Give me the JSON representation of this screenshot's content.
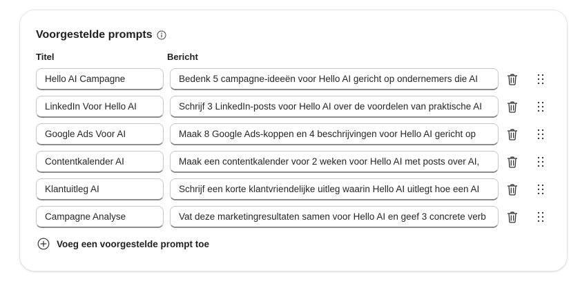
{
  "section": {
    "title": "Voorgestelde prompts",
    "info_icon": "info-icon"
  },
  "columns": {
    "title": "Titel",
    "message": "Bericht"
  },
  "prompts": [
    {
      "title": "Hello AI Campagne",
      "message": "Bedenk 5 campagne-ideeën voor Hello AI gericht op ondernemers die AI"
    },
    {
      "title": "LinkedIn Voor Hello AI",
      "message": "Schrijf 3 LinkedIn-posts voor Hello AI over de voordelen van praktische AI"
    },
    {
      "title": "Google Ads Voor AI",
      "message": "Maak 8 Google Ads-koppen en 4 beschrijvingen voor Hello AI gericht op"
    },
    {
      "title": "Contentkalender AI",
      "message": "Maak een contentkalender voor 2 weken voor Hello AI met posts over AI,"
    },
    {
      "title": "Klantuitleg AI",
      "message": "Schrijf een korte klantvriendelijke uitleg waarin Hello AI uitlegt hoe een AI"
    },
    {
      "title": "Campagne Analyse",
      "message": "Vat deze marketingresultaten samen voor Hello AI en geef 3 concrete verb"
    }
  ],
  "add_button": {
    "label": "Voeg een voorgestelde prompt toe",
    "icon": "plus-circle-icon"
  },
  "row_icons": {
    "delete": "trash-icon",
    "drag": "drag-handle-icon"
  }
}
